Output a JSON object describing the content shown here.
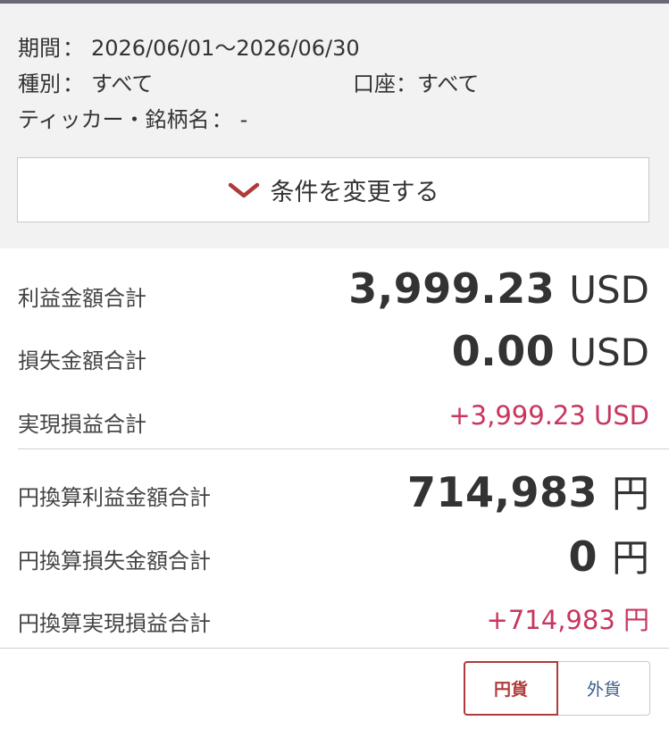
{
  "filters": {
    "period_label": "期間",
    "period_value": "2026/06/01〜2026/06/30",
    "type_label": "種別",
    "type_value": "すべて",
    "account_label": "口座",
    "account_value": "すべて",
    "ticker_label": "ティッカー・銘柄名",
    "ticker_value": "-",
    "separator": "：",
    "change_button_label": "条件を変更する"
  },
  "summary_usd": {
    "profit_label": "利益金額合計",
    "profit_value": "3,999.23",
    "profit_unit": "USD",
    "loss_label": "損失金額合計",
    "loss_value": "0.00",
    "loss_unit": "USD",
    "realized_label": "実現損益合計",
    "realized_value": "+3,999.23 USD"
  },
  "summary_jpy": {
    "profit_label": "円換算利益金額合計",
    "profit_value": "714,983",
    "profit_unit": "円",
    "loss_label": "円換算損失金額合計",
    "loss_value": "0",
    "loss_unit": "円",
    "realized_label": "円換算実現損益合計",
    "realized_value": "+714,983 円"
  },
  "currency_toggle": {
    "yen_label": "円貨",
    "foreign_label": "外貨",
    "selected": "円貨"
  },
  "colors": {
    "accent": "#b03a3a",
    "gain": "#c8365e",
    "link": "#3a5a8a"
  }
}
